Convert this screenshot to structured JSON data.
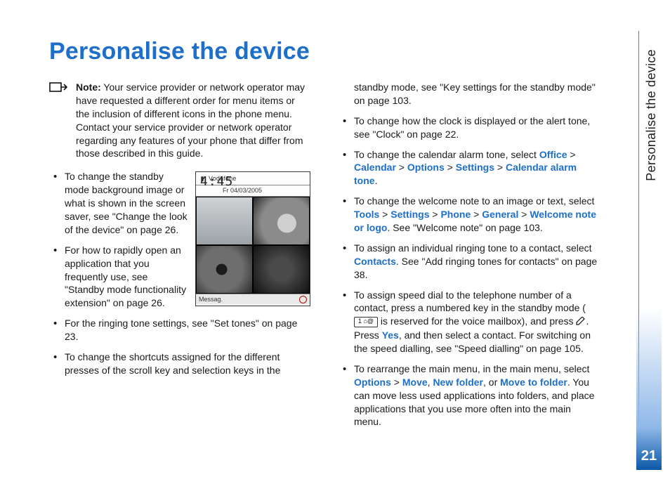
{
  "header": {
    "title": "Personalise the device"
  },
  "side_tab": "Personalise the device",
  "page_number": "21",
  "note": {
    "label": "Note:",
    "text": " Your service provider or network operator may have requested a different order for menu items or the inclusion of different icons in the phone menu. Contact your service provider or network operator regarding any features of your phone that differ from those described in this guide."
  },
  "phone": {
    "operator": "Vodafone",
    "clock": "4:45",
    "date": "Fr 04/03/2005",
    "softkey_left": "Messag."
  },
  "left_items": {
    "i0": "To change the standby mode background image or what is shown in the screen saver, see \"Change the look of the device\" on page 26.",
    "i1": "For how to rapidly open an application that you frequently use, see \"Standby mode functionality extension\" on page 26.",
    "i2": "For the ringing tone settings, see \"Set tones\" on page 23.",
    "i3": "To change the shortcuts assigned for the different presses of the scroll key and selection keys in the"
  },
  "right_items": {
    "r0": "standby mode, see \"Key settings for the standby mode\" on page 103.",
    "r1": "To change how the clock is displayed or the alert tone, see \"Clock\" on page 22.",
    "r2a": "To change the calendar alarm tone, select ",
    "r2_office": "Office",
    "r2_cal": "Calendar",
    "r2_opt": "Options",
    "r2_set": "Settings",
    "r2_cat": "Calendar alarm tone",
    "r3a": "To change the welcome note to an image or text, select ",
    "r3_tools": "Tools",
    "r3_set": "Settings",
    "r3_phone": "Phone",
    "r3_gen": "General",
    "r3_wel": "Welcome note or logo",
    "r3b": ". See \"Welcome note\" on page 103.",
    "r4a": "To assign an individual ringing tone to a contact, select ",
    "r4_contacts": "Contacts",
    "r4b": ". See \"Add ringing tones for contacts\" on page 38.",
    "r5a": "To assign speed dial to the telephone number of a contact, press a numbered key in the standby mode ( ",
    "r5_key": "1 ⌂@",
    "r5b": " is reserved for the voice mailbox), and press ",
    "r5c": ". Press ",
    "r5_yes": "Yes",
    "r5d": ", and then select a contact. For switching on the speed dialling, see \"Speed dialling\" on page 105.",
    "r6a": "To rearrange the main menu, in the main menu, select ",
    "r6_opt": "Options",
    "r6_move": "Move",
    "r6_new": "New folder",
    "r6_or": ", or ",
    "r6_mtf": "Move to folder",
    "r6b": ". You can move less used applications into folders, and place applications that you use more often into the main menu."
  },
  "sep": " > ",
  "comma": ", "
}
